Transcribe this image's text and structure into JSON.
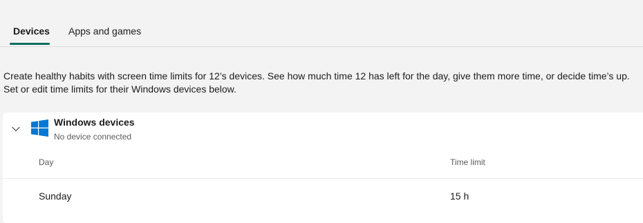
{
  "tabs": [
    {
      "label": "Devices",
      "active": true
    },
    {
      "label": "Apps and games",
      "active": false
    }
  ],
  "description": {
    "line1": "Create healthy habits with screen time limits for 12’s devices. See how much time 12 has left for the day, give them more time, or decide time’s up.",
    "line2": "Set or edit time limits for their Windows devices below."
  },
  "windows_card": {
    "icon": "windows-logo-icon",
    "expand_icon": "chevron-down-icon",
    "title": "Windows devices",
    "subtitle": "No device connected",
    "table": {
      "headers": [
        "Day",
        "Time limit"
      ],
      "rows": [
        {
          "day": "Sunday",
          "limit": "15 h"
        }
      ]
    }
  },
  "colors": {
    "accent": "#0f6e5e",
    "windows_blue": "#0078d4",
    "page_bg": "#f3f3f3",
    "card_bg": "#ffffff"
  }
}
